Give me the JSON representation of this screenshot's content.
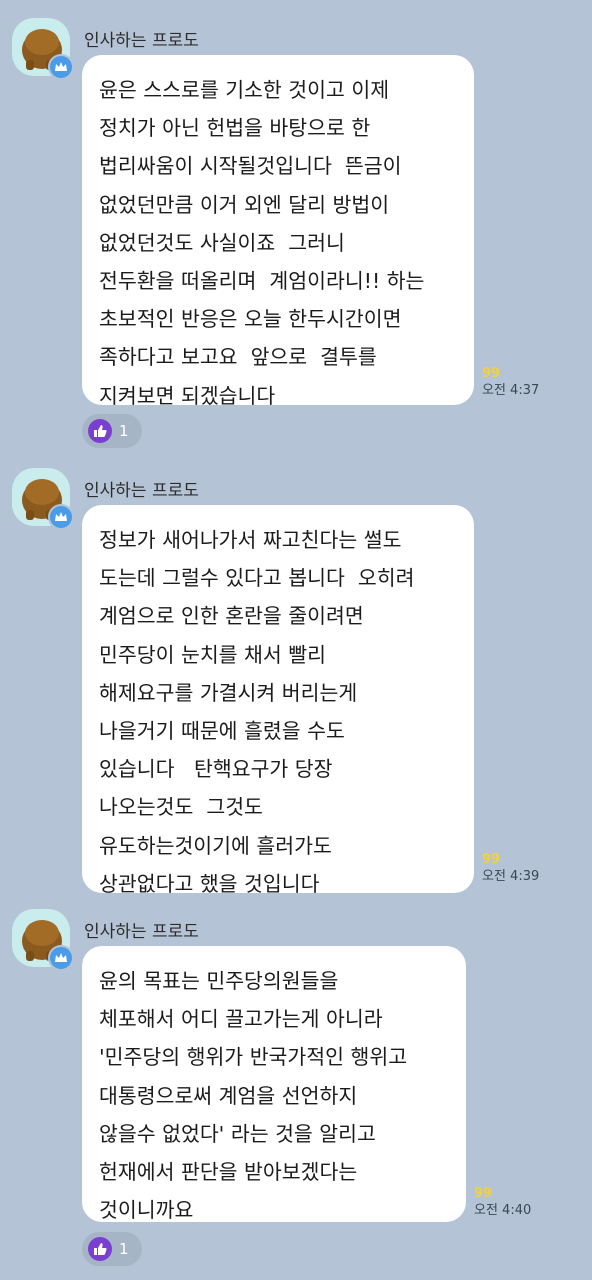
{
  "messages": [
    {
      "sender": "인사하는 프로도",
      "lines": [
        "윤은 스스로를 기소한 것이고 이제",
        "정치가 아닌 헌법을 바탕으로 한",
        "법리싸움이 시작될것입니다  뜬금이",
        "없었던만큼 이거 외엔 달리 방법이",
        "없었던것도 사실이죠  그러니",
        "전두환을 떠올리며  계엄이라니!! 하는",
        "초보적인 반응은 오늘 한두시간이면",
        "족하다고 보고요  앞으로  결투를",
        "지켜보면 되겠습니다"
      ],
      "unread": "99",
      "time": "오전 4:37",
      "reaction": {
        "icon": "thumbs-up-icon",
        "count": "1"
      }
    },
    {
      "sender": "인사하는 프로도",
      "lines": [
        "정보가 새어나가서 짜고친다는 썰도",
        "도는데 그럴수 있다고 봅니다  오히려",
        "계엄으로 인한 혼란을 줄이려면",
        "민주당이 눈치를 채서 빨리",
        "해제요구를 가결시켜 버리는게",
        "나을거기 때문에 흘렸을 수도",
        "있습니다   탄핵요구가 당장",
        "나오는것도  그것도",
        "유도하는것이기에 흘러가도",
        "상관없다고 했을 것입니다"
      ],
      "unread": "99",
      "time": "오전 4:39"
    },
    {
      "sender": "인사하는 프로도",
      "lines": [
        "윤의 목표는 민주당의원들을",
        "체포해서 어디 끌고가는게 아니라",
        "'민주당의 행위가 반국가적인 행위고",
        "대통령으로써 계엄을 선언하지",
        "않을수 없었다' 라는 것을 알리고",
        "헌재에서 판단을 받아보겠다는",
        "것이니까요"
      ],
      "unread": "99",
      "time": "오전 4:40",
      "reaction": {
        "icon": "thumbs-up-icon",
        "count": "1"
      }
    }
  ],
  "colors": {
    "background": "#b4c3d5",
    "bubble": "#ffffff",
    "unread": "#f1d23a",
    "reaction_bg": "#a6b5c6",
    "thumb": "#7a3fd0",
    "crown_badge": "#4a9be8"
  },
  "icons": {
    "avatar_badge": "crown-icon",
    "avatar": "avatar-character"
  }
}
